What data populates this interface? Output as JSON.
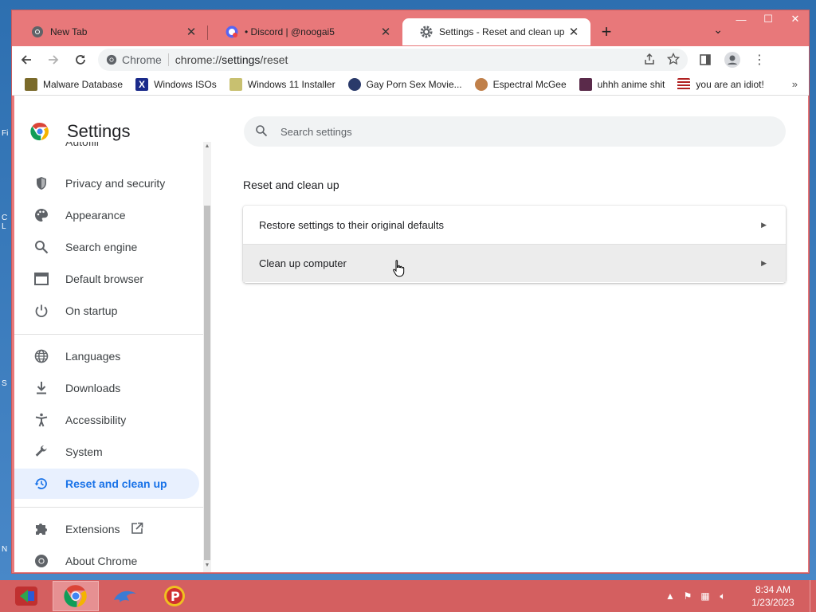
{
  "tabs": [
    {
      "label": "New Tab",
      "icon": "chrome-icon"
    },
    {
      "label": "• Discord | @noogai5",
      "icon": "discord-icon"
    },
    {
      "label": "Settings - Reset and clean up",
      "icon": "gear-icon"
    }
  ],
  "omnibox": {
    "site_label": "Chrome",
    "url_prefix": "chrome://",
    "url_host": "settings",
    "url_path": "/reset"
  },
  "bookmarks": [
    {
      "label": "Malware Database",
      "color": "#7a6a2a"
    },
    {
      "label": "Windows ISOs",
      "color": "#1a2a8a"
    },
    {
      "label": "Windows 11 Installer",
      "color": "#8a8a2a"
    },
    {
      "label": "Gay Porn Sex Movie...",
      "color": "#2a3a6a"
    },
    {
      "label": "Espectral McGee",
      "color": "#c0804a"
    },
    {
      "label": "uhhh anime shit",
      "color": "#5a2a4a"
    },
    {
      "label": "you are an idiot!",
      "color": "#b02020"
    }
  ],
  "settings": {
    "title": "Settings",
    "partial_item": "Autofill",
    "nav": [
      {
        "label": "Privacy and security",
        "icon": "shield-icon"
      },
      {
        "label": "Appearance",
        "icon": "palette-icon"
      },
      {
        "label": "Search engine",
        "icon": "search-icon"
      },
      {
        "label": "Default browser",
        "icon": "browser-window-icon"
      },
      {
        "label": "On startup",
        "icon": "power-icon"
      },
      {
        "label": "Languages",
        "icon": "globe-icon"
      },
      {
        "label": "Downloads",
        "icon": "download-icon"
      },
      {
        "label": "Accessibility",
        "icon": "accessibility-icon"
      },
      {
        "label": "System",
        "icon": "wrench-icon"
      },
      {
        "label": "Reset and clean up",
        "icon": "history-icon",
        "active": true
      },
      {
        "label": "Extensions",
        "icon": "puzzle-icon"
      },
      {
        "label": "About Chrome",
        "icon": "chrome-icon"
      }
    ],
    "search_placeholder": "Search settings",
    "section_title": "Reset and clean up",
    "rows": [
      {
        "label": "Restore settings to their original defaults"
      },
      {
        "label": "Clean up computer"
      }
    ]
  },
  "taskbar": {
    "time": "8:34 AM",
    "date": "1/23/2023"
  },
  "colors": {
    "accent": "#1a73e8",
    "active_nav_bg": "#e8f0fe",
    "window_frame": "#e8787a",
    "taskbar": "#d45f60"
  }
}
